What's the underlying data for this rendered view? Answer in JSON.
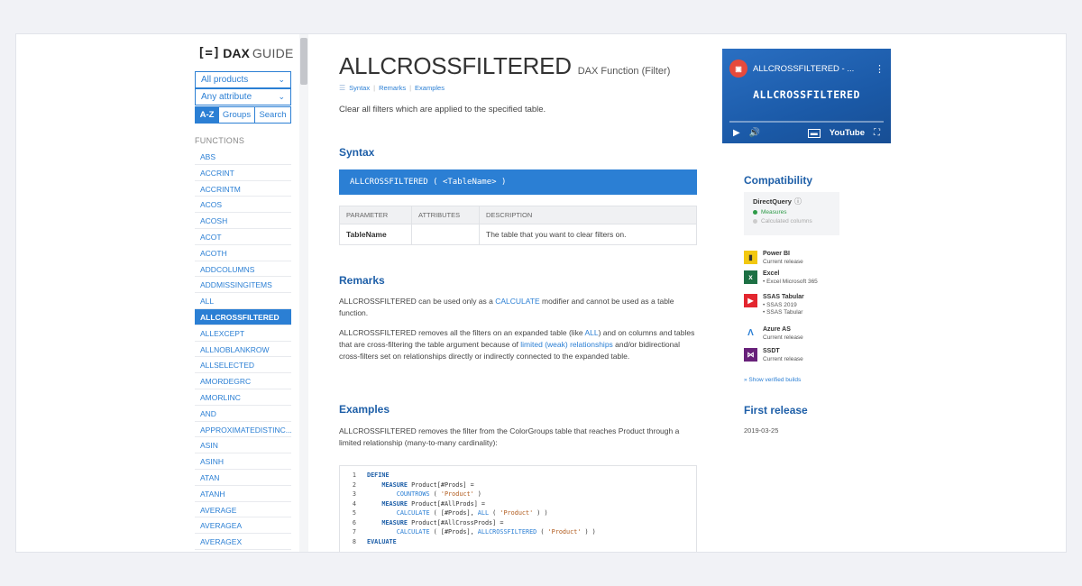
{
  "logo": {
    "icon": "[=]",
    "dax": "DAX",
    "guide": "GUIDE"
  },
  "sidebar": {
    "products_select": "All products",
    "attribute_select": "Any attribute",
    "tabs": [
      "A-Z",
      "Groups",
      "Search"
    ],
    "functions_header": "FUNCTIONS",
    "functions": [
      "ABS",
      "ACCRINT",
      "ACCRINTM",
      "ACOS",
      "ACOSH",
      "ACOT",
      "ACOTH",
      "ADDCOLUMNS",
      "ADDMISSINGITEMS",
      "ALL",
      "ALLCROSSFILTERED",
      "ALLEXCEPT",
      "ALLNOBLANKROW",
      "ALLSELECTED",
      "AMORDEGRC",
      "AMORLINC",
      "AND",
      "APPROXIMATEDISTINC...",
      "ASIN",
      "ASINH",
      "ATAN",
      "ATANH",
      "AVERAGE",
      "AVERAGEA",
      "AVERAGEX"
    ],
    "active_function": "ALLCROSSFILTERED"
  },
  "main": {
    "title": "ALLCROSSFILTERED",
    "subtitle": "DAX Function (Filter)",
    "crumbs": [
      "Syntax",
      "Remarks",
      "Examples"
    ],
    "description": "Clear all filters which are applied to the specified table.",
    "syntax_heading": "Syntax",
    "syntax": "ALLCROSSFILTERED ( <TableName> )",
    "params_headers": [
      "PARAMETER",
      "ATTRIBUTES",
      "DESCRIPTION"
    ],
    "params_row": {
      "name": "TableName",
      "attributes": "",
      "description": "The table that you want to clear filters on."
    },
    "remarks_heading": "Remarks",
    "remarks1": {
      "a": "ALLCROSSFILTERED can be used only as a ",
      "link": "CALCULATE",
      "b": " modifier and cannot be used as a table function."
    },
    "remarks2": {
      "a": "ALLCROSSFILTERED removes all the filters on an expanded table (like ",
      "link1": "ALL",
      "b": ") and on columns and tables that are cross-filtering the table argument because of ",
      "link2": "limited (weak) relationships",
      "c": " and/or bidirectional cross-filters set on relationships directly or indirectly connected to the expanded table."
    },
    "examples_heading": "Examples",
    "examples_text": "ALLCROSSFILTERED removes the filter from the ColorGroups table that reaches Product through a limited relationship (many-to-many cardinality):",
    "code": {
      "l1": {
        "n": "1",
        "kw": "DEFINE"
      },
      "l2": {
        "n": "2",
        "kw": "MEASURE",
        "rest": " Product[#Prods] ="
      },
      "l3": {
        "n": "3",
        "fn": "COUNTROWS",
        "rest": " ( ",
        "str": "'Product'",
        "end": " )"
      },
      "l4": {
        "n": "4",
        "kw": "MEASURE",
        "rest": " Product[#AllProds] ="
      },
      "l5": {
        "n": "5",
        "fn": "CALCULATE",
        "rest": " ( [#Prods], ",
        "fn2": "ALL",
        "rest2": " ( ",
        "str": "'Product'",
        "end": " ) )"
      },
      "l6": {
        "n": "6",
        "kw": "MEASURE",
        "rest": " Product[#AllCrossProds] ="
      },
      "l7": {
        "n": "7",
        "fn": "CALCULATE",
        "rest": " ( [#Prods], ",
        "fn2": "ALLCROSSFILTERED",
        "rest2": " ( ",
        "str": "'Product'",
        "end": " ) )"
      },
      "l8": {
        "n": "8",
        "kw": "EVALUATE"
      }
    }
  },
  "right": {
    "video": {
      "header": "ALLCROSSFILTERED - ...",
      "title": "ALLCROSSFILTERED",
      "youtube": "YouTube"
    },
    "compat_heading": "Compatibility",
    "directquery": {
      "title": "DirectQuery",
      "measures": "Measures",
      "calc_columns": "Calculated columns"
    },
    "products": [
      {
        "name": "Power BI",
        "detail": "Current release",
        "color": "#f2c811"
      },
      {
        "name": "Excel",
        "detail": "• Excel Microsoft 365",
        "color": "#1d7044"
      },
      {
        "name": "SSAS Tabular",
        "detail": "• SSAS 2019",
        "detail2": "• SSAS Tabular",
        "color": "#e3262f"
      },
      {
        "name": "Azure AS",
        "detail": "Current release",
        "color": "#2b7fd4"
      },
      {
        "name": "SSDT",
        "detail": "Current release",
        "color": "#68217a"
      }
    ],
    "show_builds": "» Show verified builds",
    "first_release_heading": "First release",
    "first_release_date": "2019-03-25"
  }
}
